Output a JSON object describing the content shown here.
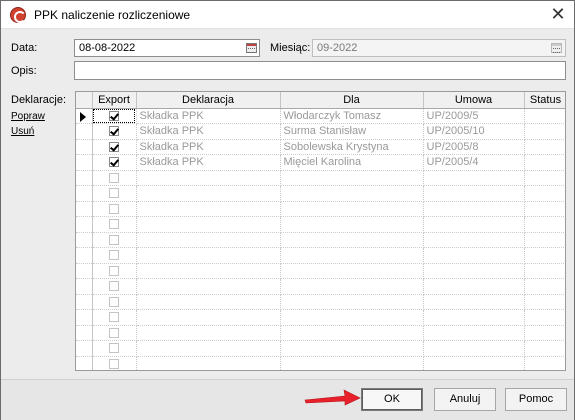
{
  "window": {
    "title": "PPK naliczenie rozliczeniowe",
    "close_glyph": "✕"
  },
  "form": {
    "data_label": "Data:",
    "data_value": "08-08-2022",
    "miesiac_label": "Miesiąc:",
    "miesiac_value": "09-2022",
    "opis_label": "Opis:",
    "opis_value": ""
  },
  "side": {
    "deklaracje_label": "Deklaracje:",
    "popraw_label": "Popraw",
    "usun_label": "Usuń"
  },
  "table": {
    "columns": [
      "Export",
      "Deklaracja",
      "Dla",
      "Umowa",
      "Status"
    ],
    "rows": [
      {
        "export": true,
        "deklaracja": "Składka PPK",
        "dla": "Włodarczyk Tomasz",
        "umowa": "UP/2009/5",
        "status": ""
      },
      {
        "export": true,
        "deklaracja": "Składka PPK",
        "dla": "Surma Stanisław",
        "umowa": "UP/2005/10",
        "status": ""
      },
      {
        "export": true,
        "deklaracja": "Składka PPK",
        "dla": "Sobolewska Krystyna",
        "umowa": "UP/2005/8",
        "status": ""
      },
      {
        "export": true,
        "deklaracja": "Składka PPK",
        "dla": "Mięciel Karolina",
        "umowa": "UP/2005/4",
        "status": ""
      }
    ],
    "empty_rows": 13
  },
  "buttons": {
    "ok": "OK",
    "anuluj": "Anuluj",
    "pomoc": "Pomoc"
  },
  "colors": {
    "annotation_arrow": "#e8202a",
    "disabled_text": "#9a9a9a"
  },
  "icons": {
    "app": "ppk-app-icon",
    "calendar": "calendar-icon",
    "current_row": "row-pointer-icon"
  }
}
